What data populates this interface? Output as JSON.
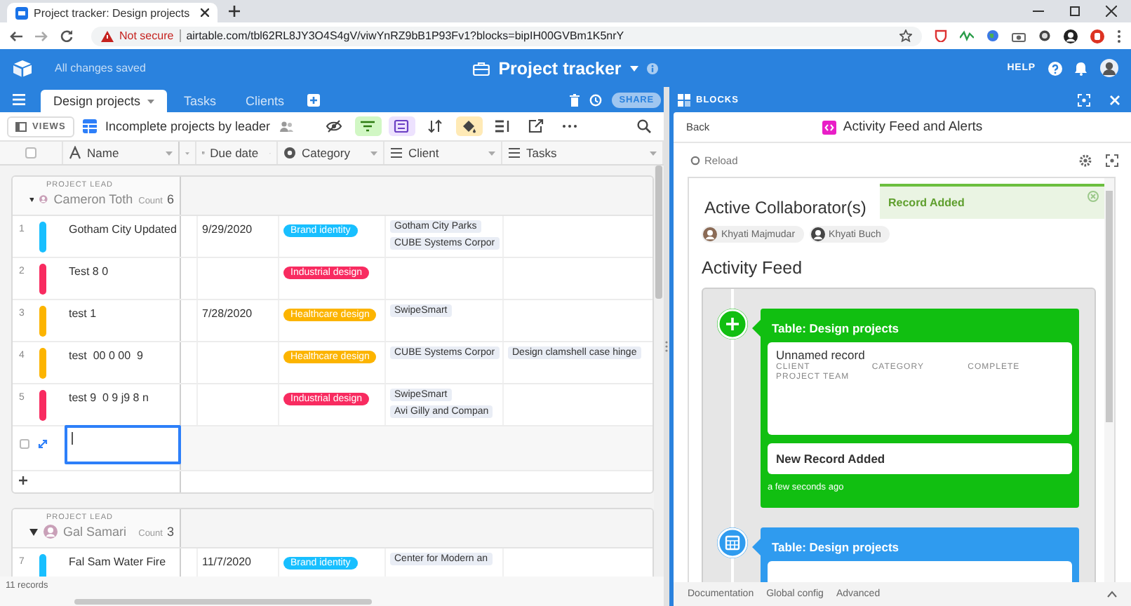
{
  "browser": {
    "tab_title": "Project tracker: Design projects",
    "security_label": "Not secure",
    "url": "airtable.com/tbl62RL8JY3O4S4gV/viwYnRZ9bB1P93Fv1?blocks=bipIH00GVBm1K5nrY"
  },
  "app_bar": {
    "status": "All changes saved",
    "base_title": "Project tracker",
    "help": "HELP"
  },
  "table_tabs": [
    {
      "label": "Design projects",
      "selected": true
    },
    {
      "label": "Tasks",
      "selected": false
    },
    {
      "label": "Clients",
      "selected": false
    }
  ],
  "share": "SHARE",
  "view_bar": {
    "views_button": "VIEWS",
    "view_name": "Incomplete projects by leader",
    "tools": [
      {
        "kind": "hide",
        "active": false
      },
      {
        "kind": "filter",
        "active": true
      },
      {
        "kind": "group",
        "active": true
      },
      {
        "kind": "sort",
        "active": false
      },
      {
        "kind": "color",
        "active": true
      },
      {
        "kind": "row_height",
        "active": false
      },
      {
        "kind": "share",
        "active": false
      },
      {
        "kind": "more",
        "active": false
      }
    ]
  },
  "select_all": {
    "checked": false
  },
  "columns": [
    {
      "kind": "text",
      "label": "Name"
    },
    {
      "kind": "date",
      "label": "Due date"
    },
    {
      "kind": "select",
      "label": "Category"
    },
    {
      "kind": "link",
      "label": "Client"
    },
    {
      "kind": "link",
      "label": "Tasks"
    }
  ],
  "groups": [
    {
      "label": "PROJECT LEAD",
      "leader": "Cameron Toth",
      "count_label": "Count",
      "count": "6",
      "expanded": true,
      "rows": [
        {
          "number": "1",
          "name": "Gotham City Updated",
          "due_date": "9/29/2020",
          "category": {
            "label": "Brand identity",
            "color": "#18bfff"
          },
          "clients": [
            "Gotham City Parks",
            "CUBE Systems Corpor"
          ]
        },
        {
          "number": "2",
          "name": "Test 8 0",
          "category": {
            "label": "Industrial design",
            "color": "#f82b60"
          }
        },
        {
          "number": "3",
          "name": "test 1",
          "due_date": "7/28/2020",
          "category": {
            "label": "Healthcare design",
            "color": "#fcb400"
          },
          "clients": [
            "SwipeSmart"
          ]
        },
        {
          "number": "4",
          "name": "test  00 0 00  9",
          "category": {
            "label": "Healthcare design",
            "color": "#fcb400"
          },
          "clients": [
            "CUBE Systems Corpor"
          ],
          "tasks": [
            "Design clamshell case hinge"
          ]
        },
        {
          "number": "5",
          "name": "test 9  0 9 j9 8 n",
          "category": {
            "label": "Industrial design",
            "color": "#f82b60"
          },
          "clients": [
            "SwipeSmart",
            "Avi Gilly and Compan"
          ]
        }
      ],
      "draft_row": {
        "selected": true,
        "checked": false
      }
    },
    {
      "label": "PROJECT LEAD",
      "leader": "Gal Samari",
      "count_label": "Count",
      "count": "3",
      "expanded": true,
      "rows": [
        {
          "number": "7",
          "name": "Fal Sam Water Fire",
          "due_date": "11/7/2020",
          "category": {
            "label": "Brand identity",
            "color": "#18bfff"
          },
          "clients": [
            "Center for Modern an"
          ]
        }
      ]
    }
  ],
  "footer": "11 records",
  "blocks": {
    "header": "BLOCKS",
    "back": "Back",
    "title": "Activity Feed and Alerts",
    "reload": "Reload",
    "toast": "Record Added",
    "collaborators_heading": "Active Collaborator(s)",
    "collaborators": [
      "Khyati Majmudar",
      "Khyati Buch"
    ],
    "feed_heading": "Activity Feed",
    "events": [
      {
        "kind": "created",
        "table": "Table: Design projects",
        "record": "Unnamed record",
        "fields": [
          "CLIENT",
          "CATEGORY",
          "COMPLETE",
          "PROJECT TEAM"
        ],
        "message": "New Record Added",
        "time": "a few seconds ago"
      },
      {
        "kind": "updated",
        "table": "Table: Design projects"
      }
    ],
    "footer_links": [
      "Documentation",
      "Global config",
      "Advanced"
    ]
  }
}
